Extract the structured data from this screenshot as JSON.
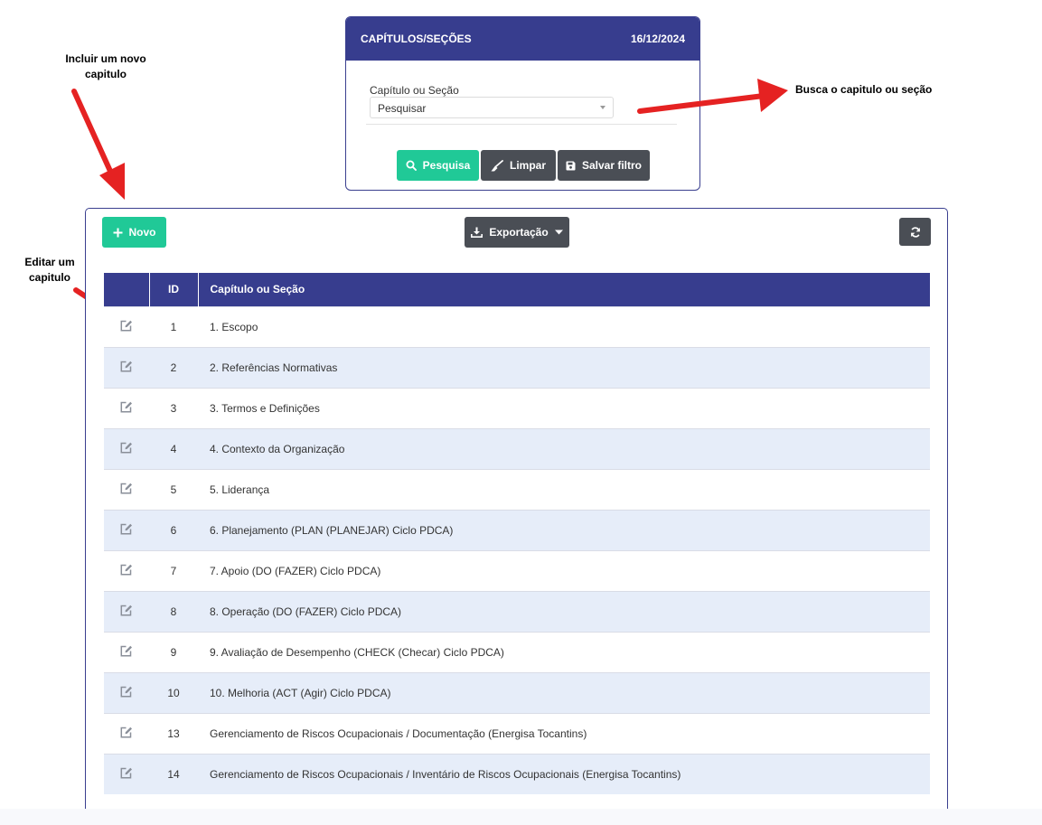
{
  "search": {
    "title": "CAPÍTULOS/SEÇÕES",
    "date": "16/12/2024",
    "field_label": "Capítulo ou Seção",
    "select_value": "Pesquisar",
    "buttons": {
      "search": "Pesquisa",
      "clear": "Limpar",
      "save_filter": "Salvar filtro"
    }
  },
  "annotations": {
    "new_chapter": "Incluir um novo capitulo",
    "search_chapter": "Busca o capitulo ou seção",
    "edit_chapter": "Editar um capitulo"
  },
  "toolbar": {
    "new_label": "Novo",
    "export_label": "Exportação"
  },
  "table": {
    "headers": [
      "",
      "ID",
      "Capítulo ou Seção"
    ],
    "rows": [
      {
        "id": "1",
        "name": "1. Escopo"
      },
      {
        "id": "2",
        "name": "2. Referências Normativas"
      },
      {
        "id": "3",
        "name": "3. Termos e Definições"
      },
      {
        "id": "4",
        "name": "4. Contexto da Organização"
      },
      {
        "id": "5",
        "name": "5. Liderança"
      },
      {
        "id": "6",
        "name": "6. Planejamento (PLAN (PLANEJAR) Ciclo PDCA)"
      },
      {
        "id": "7",
        "name": "7. Apoio (DO (FAZER) Ciclo PDCA)"
      },
      {
        "id": "8",
        "name": "8. Operação (DO (FAZER) Ciclo PDCA)"
      },
      {
        "id": "9",
        "name": "9. Avaliação de Desempenho (CHECK (Checar) Ciclo PDCA)"
      },
      {
        "id": "10",
        "name": "10. Melhoria (ACT (Agir) Ciclo PDCA)"
      },
      {
        "id": "13",
        "name": "Gerenciamento de Riscos Ocupacionais / Documentação (Energisa Tocantins)"
      },
      {
        "id": "14",
        "name": "Gerenciamento de Riscos Ocupacionais / Inventário de Riscos Ocupacionais (Energisa Tocantins)"
      }
    ]
  },
  "icons": {
    "search": "search-icon",
    "clear": "broom-icon",
    "save": "save-icon",
    "new": "plus-icon",
    "export": "download-icon",
    "export_caret": "caret-down-icon",
    "refresh": "refresh-icon",
    "edit": "edit-icon"
  },
  "colors": {
    "header_navy": "#373d8e",
    "accent_green": "#20c997",
    "button_dark": "#4a4e55",
    "row_alt": "#e6edf9",
    "annotation_arrow": "#e52222"
  }
}
